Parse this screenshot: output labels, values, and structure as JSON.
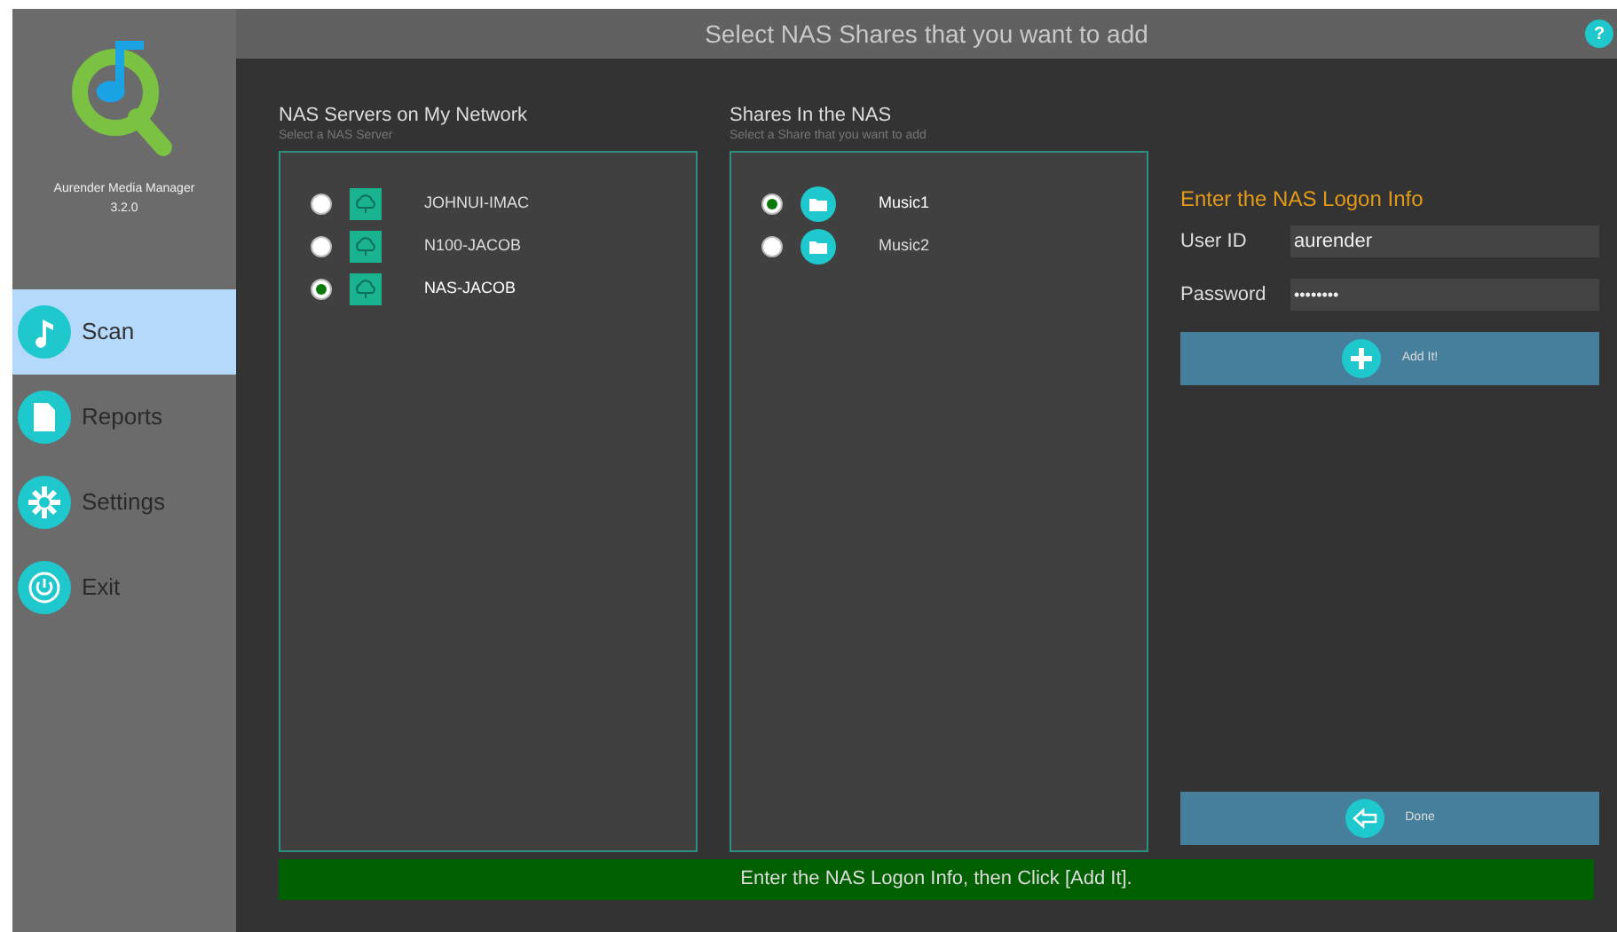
{
  "app": {
    "name": "Aurender Media Manager",
    "version": "3.2.0"
  },
  "sidebar": {
    "items": [
      {
        "label": "Scan",
        "kind": "note",
        "selected": true
      },
      {
        "label": "Reports",
        "kind": "page",
        "selected": false
      },
      {
        "label": "Settings",
        "kind": "gear",
        "selected": false
      },
      {
        "label": "Exit",
        "kind": "power",
        "selected": false
      }
    ]
  },
  "header": {
    "title": "Select NAS Shares that you want to add",
    "help": "?"
  },
  "servers": {
    "title": "NAS Servers on My Network",
    "subtitle": "Select a NAS Server",
    "items": [
      {
        "label": "JOHNUI-IMAC",
        "selected": false
      },
      {
        "label": "N100-JACOB",
        "selected": false
      },
      {
        "label": "NAS-JACOB",
        "selected": true
      }
    ]
  },
  "shares": {
    "title": "Shares In the NAS",
    "subtitle": "Select a Share that you want to add",
    "items": [
      {
        "label": "Music1",
        "selected": true
      },
      {
        "label": "Music2",
        "selected": false
      }
    ]
  },
  "logon": {
    "title": "Enter the NAS Logon Info",
    "user_label": "User ID",
    "user_value": "aurender",
    "password_label": "Password",
    "password_value": "••••••••",
    "add_button": "Add It!"
  },
  "done_button": "Done",
  "status": "Enter the NAS Logon Info, then Click [Add It]."
}
